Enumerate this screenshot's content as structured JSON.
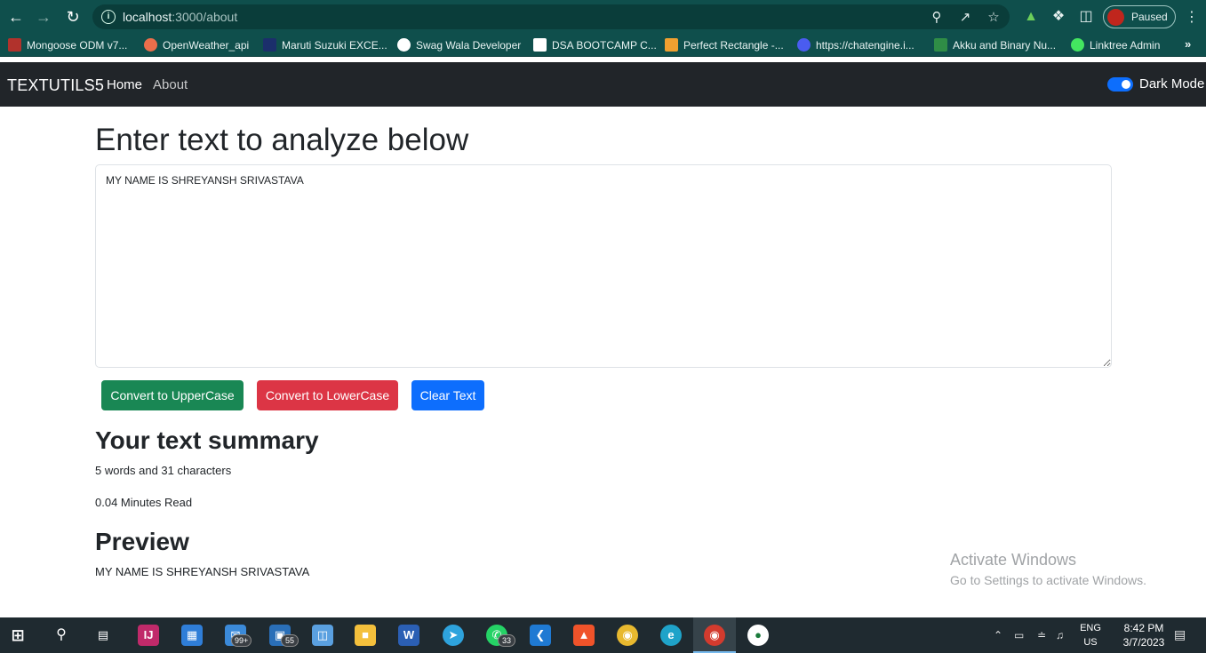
{
  "browser": {
    "url_host": "localhost",
    "url_path": ":3000/about",
    "profile_label": "Paused",
    "accent_color": "#0f4f4c",
    "bookmarks": [
      {
        "label": "Mongoose ODM v7...",
        "icon": "mongoose-icon",
        "color": "#b1322c"
      },
      {
        "label": "OpenWeather_api",
        "icon": "openweather-icon",
        "color": "#eb6e4b"
      },
      {
        "label": "Maruti Suzuki EXCE...",
        "icon": "unstop-icon",
        "color": "#1b2f6b"
      },
      {
        "label": "Swag Wala Developer",
        "icon": "globe-icon",
        "color": "#ffffff"
      },
      {
        "label": "DSA BOOTCAMP C...",
        "icon": "notion-icon",
        "color": "#ffffff"
      },
      {
        "label": "Perfect Rectangle -...",
        "icon": "leetcode-icon",
        "color": "#f0a030"
      },
      {
        "label": "https://chatengine.i...",
        "icon": "chatengine-icon",
        "color": "#4a5cf0"
      },
      {
        "label": "Akku and Binary Nu...",
        "icon": "gfg-icon",
        "color": "#2f8d46"
      },
      {
        "label": "Linktree Admin",
        "icon": "linktree-icon",
        "color": "#43e660"
      }
    ]
  },
  "navbar": {
    "brand": "TEXTUTILS5",
    "links": [
      "Home",
      "About"
    ],
    "dark_mode_label": "Dark Mode",
    "dark_mode_on": true
  },
  "main": {
    "heading": "Enter text to analyze below",
    "textarea_value": "MY NAME IS SHREYANSH SRIVASTAVA",
    "buttons": {
      "upper": "Convert to UpperCase",
      "lower": "Convert to LowerCase",
      "clear": "Clear Text"
    },
    "summary_heading": "Your text summary",
    "word_char_count": "5 words and 31 characters",
    "read_time": "0.04 Minutes Read",
    "preview_heading": "Preview",
    "preview_text": "MY NAME IS SHREYANSH SRIVASTAVA"
  },
  "watermark": {
    "line1": "Activate Windows",
    "line2": "Go to Settings to activate Windows."
  },
  "taskbar": {
    "badges": {
      "mail": "99+",
      "photos": "55",
      "whatsapp": "33"
    },
    "lang_line1": "ENG",
    "lang_line2": "US",
    "time": "8:42 PM",
    "date": "3/7/2023"
  }
}
